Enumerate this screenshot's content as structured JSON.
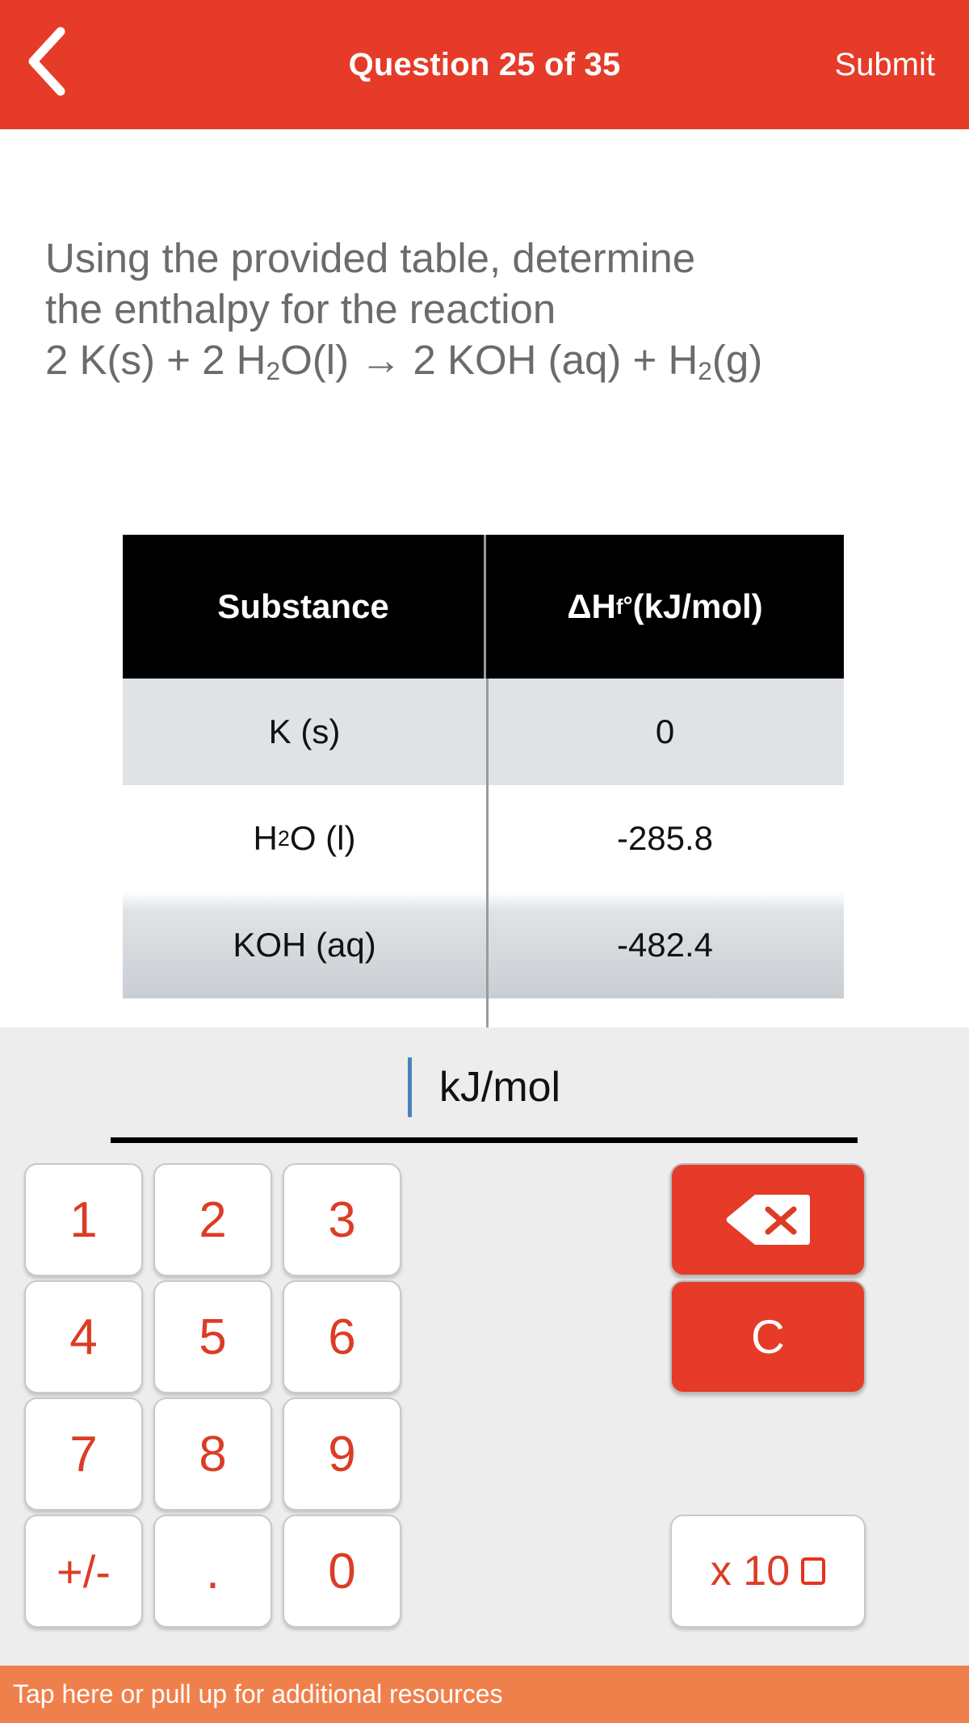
{
  "header": {
    "back_icon": "chevron-left-icon",
    "title": "Question 25 of 35",
    "submit_label": "Submit",
    "background_color": "#E53B28"
  },
  "question": {
    "line1": "Using the provided table, determine",
    "line2": "the enthalpy for the reaction",
    "equation_pre": "2 K(s) + 2 H",
    "equation_sub1": "2",
    "equation_mid": "O(l) → 2 KOH (aq) + H",
    "equation_sub2": "2",
    "equation_post": "(g)"
  },
  "table": {
    "header": {
      "col1": "Substance",
      "col2_delta_h": "ΔH",
      "col2_sub": "f",
      "col2_deg": "°",
      "col2_unit": " (kJ/mol)"
    },
    "rows": [
      {
        "substance_pre": "K (s)",
        "substance_sub": "",
        "substance_post": "",
        "value": "0",
        "shade": "shaded"
      },
      {
        "substance_pre": "H",
        "substance_sub": "2",
        "substance_post": "O (l)",
        "value": "-285.8",
        "shade": "plain"
      },
      {
        "substance_pre": "KOH (aq)",
        "substance_sub": "",
        "substance_post": "",
        "value": "-482.4",
        "shade": "fade"
      }
    ]
  },
  "answer": {
    "value": "",
    "unit": "kJ/mol",
    "caret_color": "#4a83bd"
  },
  "keypad": {
    "keys": [
      {
        "label": "1",
        "name": "key-1"
      },
      {
        "label": "2",
        "name": "key-2"
      },
      {
        "label": "3",
        "name": "key-3"
      },
      {
        "label": "4",
        "name": "key-4"
      },
      {
        "label": "5",
        "name": "key-5"
      },
      {
        "label": "6",
        "name": "key-6"
      },
      {
        "label": "7",
        "name": "key-7"
      },
      {
        "label": "8",
        "name": "key-8"
      },
      {
        "label": "9",
        "name": "key-9"
      },
      {
        "label": "+/-",
        "name": "key-sign"
      },
      {
        "label": ".",
        "name": "key-decimal"
      },
      {
        "label": "0",
        "name": "key-0"
      }
    ],
    "backspace_icon": "backspace-delete-icon",
    "clear_label": "C",
    "exponent_label": "x 10",
    "key_text_color": "#DC3C26",
    "action_color": "#E53B28"
  },
  "bottom_bar": {
    "label": "Tap here or pull up for additional resources",
    "background_color": "#F0804B"
  }
}
